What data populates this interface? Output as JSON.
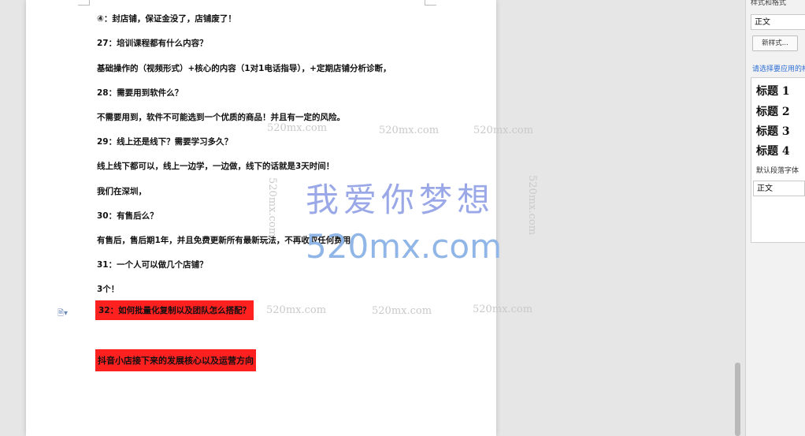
{
  "document": {
    "paragraphs": [
      {
        "id": "p1",
        "text": "④：封店铺，保证金没了，店铺废了！"
      },
      {
        "id": "p2",
        "text": "27：培训课程都有什么内容？"
      },
      {
        "id": "p3",
        "text": "基础操作的（视频形式）+核心的内容（1对1电话指导），+定期店铺分析诊断，"
      },
      {
        "id": "p4",
        "text": "28：需要用到软件么？"
      },
      {
        "id": "p5",
        "text": "不需要用到，软件不可能选到一个优质的商品！并且有一定的风险。"
      },
      {
        "id": "p6",
        "text": "29：线上还是线下？需要学习多久？"
      },
      {
        "id": "p7",
        "text": "线上线下都可以，线上一边学，一边做，线下的话就是3天时间！"
      },
      {
        "id": "p8",
        "text": "我们在深圳，"
      },
      {
        "id": "p9",
        "text": "30：有售后么？"
      },
      {
        "id": "p10",
        "text": "有售后，售后期1年，并且免费更新所有最新玩法，不再收取任何费用！"
      },
      {
        "id": "p11",
        "text": "31：一个人可以做几个店铺？"
      },
      {
        "id": "p12",
        "text": "3个！"
      }
    ],
    "highlighted": [
      {
        "id": "h1",
        "text": "32：如何批量化复制以及团队怎么搭配？"
      },
      {
        "id": "h2",
        "text": "抖音小店接下来的发展核心以及运营方向"
      }
    ],
    "highlight_color": "#ff2020"
  },
  "watermark": {
    "small": "520mx.com",
    "big_line1": "我爱你梦想",
    "big_line2": "520mx.com"
  },
  "margin_icon": "paragraph-options-icon",
  "styles_panel": {
    "title": "样式和格式",
    "current_style": "正文",
    "new_style_button": "新样式...",
    "apply_hint": "请选择要应用的格式",
    "items": [
      "标题 1",
      "标题 2",
      "标题 3",
      "标题 4"
    ],
    "default_font_label": "默认段落字体",
    "body_style": "正文"
  },
  "colors": {
    "watermark_big": "#9aa8e8",
    "link": "#2f6fd6"
  }
}
